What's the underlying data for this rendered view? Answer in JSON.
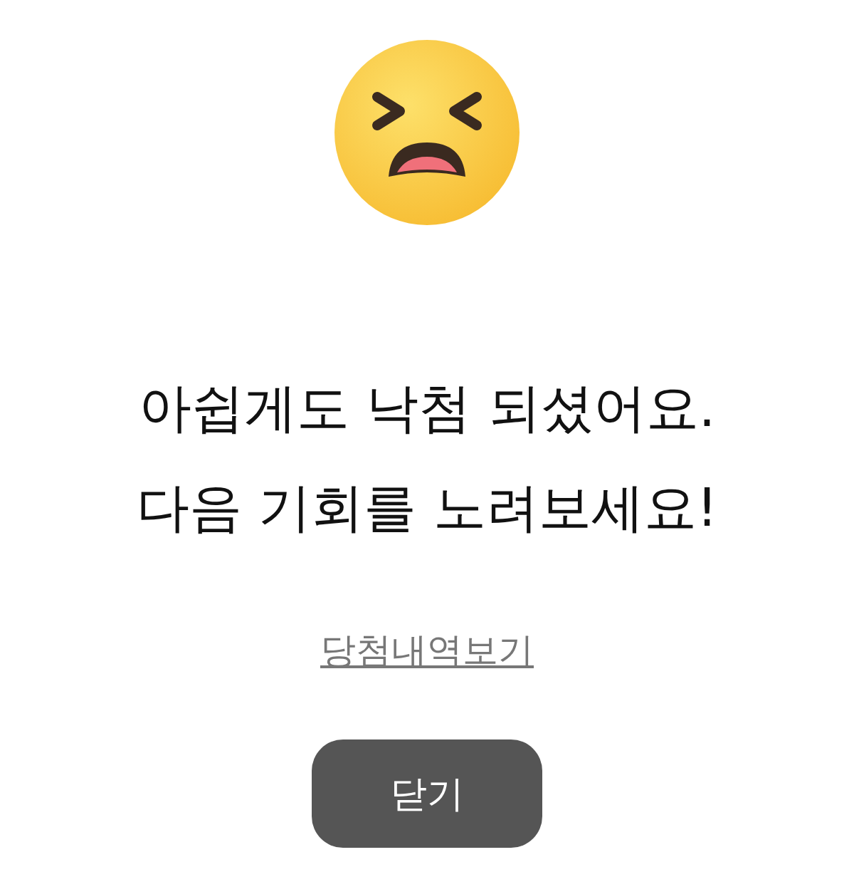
{
  "message": "아쉽게도 낙첨 되셨어요.\n다음 기회를 노려보세요!",
  "link": "당첨내역보기",
  "button": "닫기"
}
